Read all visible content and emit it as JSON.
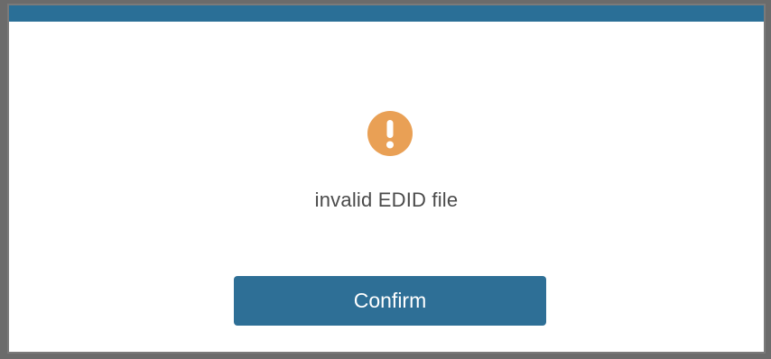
{
  "dialog": {
    "icon": "exclamation-icon",
    "message": "invalid EDID file",
    "confirm_label": "Confirm"
  },
  "colors": {
    "titlebar": "#2a6f97",
    "icon_bg": "#e9a055",
    "button_bg": "#2e6f96",
    "text": "#4a4a4a"
  }
}
